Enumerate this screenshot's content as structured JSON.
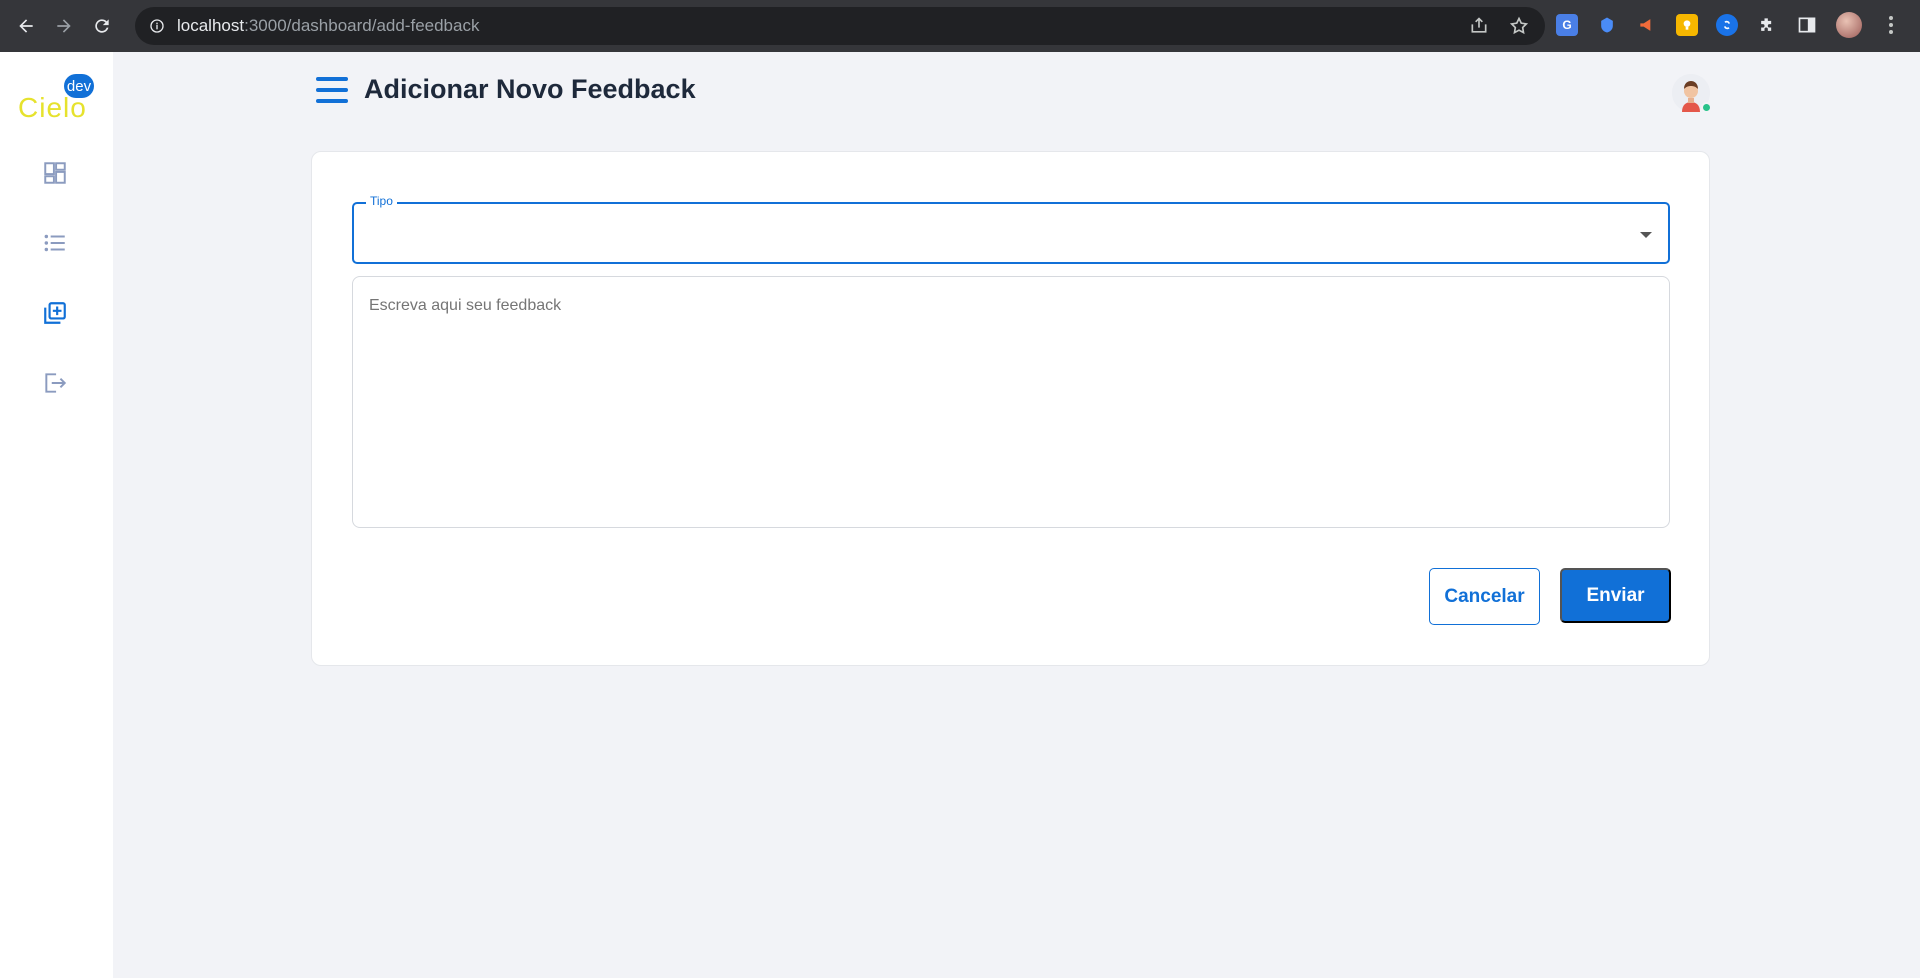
{
  "browser": {
    "url_host": "localhost",
    "url_path": ":3000/dashboard/add-feedback"
  },
  "sidebar": {
    "logo_text": "Cielo",
    "logo_badge": "dev",
    "items": [
      {
        "icon": "dashboard-icon"
      },
      {
        "icon": "list-icon"
      },
      {
        "icon": "add-library-icon",
        "active": true
      },
      {
        "icon": "logout-icon"
      }
    ]
  },
  "header": {
    "title": "Adicionar Novo Feedback"
  },
  "form": {
    "type_label": "Tipo",
    "type_value": "",
    "feedback_placeholder": "Escreva aqui seu feedback",
    "cancel_label": "Cancelar",
    "submit_label": "Enviar"
  },
  "colors": {
    "accent": "#1170d7",
    "logo": "#e6e22d",
    "status_online": "#28c28a"
  }
}
